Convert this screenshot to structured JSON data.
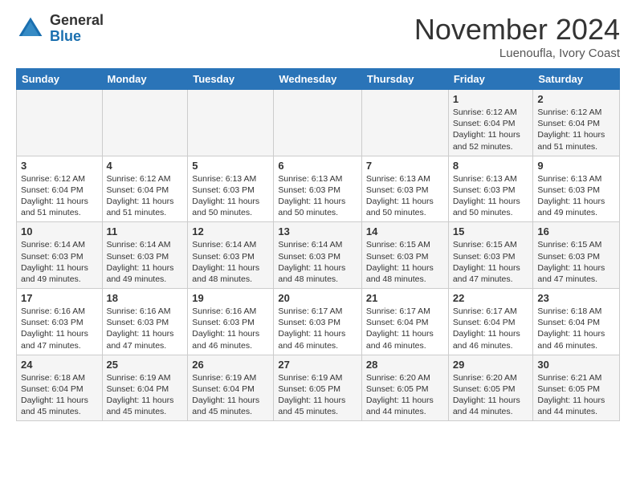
{
  "header": {
    "logo_general": "General",
    "logo_blue": "Blue",
    "month_title": "November 2024",
    "location": "Luenoufla, Ivory Coast"
  },
  "weekdays": [
    "Sunday",
    "Monday",
    "Tuesday",
    "Wednesday",
    "Thursday",
    "Friday",
    "Saturday"
  ],
  "weeks": [
    [
      {
        "day": "",
        "info": ""
      },
      {
        "day": "",
        "info": ""
      },
      {
        "day": "",
        "info": ""
      },
      {
        "day": "",
        "info": ""
      },
      {
        "day": "",
        "info": ""
      },
      {
        "day": "1",
        "info": "Sunrise: 6:12 AM\nSunset: 6:04 PM\nDaylight: 11 hours\nand 52 minutes."
      },
      {
        "day": "2",
        "info": "Sunrise: 6:12 AM\nSunset: 6:04 PM\nDaylight: 11 hours\nand 51 minutes."
      }
    ],
    [
      {
        "day": "3",
        "info": "Sunrise: 6:12 AM\nSunset: 6:04 PM\nDaylight: 11 hours\nand 51 minutes."
      },
      {
        "day": "4",
        "info": "Sunrise: 6:12 AM\nSunset: 6:04 PM\nDaylight: 11 hours\nand 51 minutes."
      },
      {
        "day": "5",
        "info": "Sunrise: 6:13 AM\nSunset: 6:03 PM\nDaylight: 11 hours\nand 50 minutes."
      },
      {
        "day": "6",
        "info": "Sunrise: 6:13 AM\nSunset: 6:03 PM\nDaylight: 11 hours\nand 50 minutes."
      },
      {
        "day": "7",
        "info": "Sunrise: 6:13 AM\nSunset: 6:03 PM\nDaylight: 11 hours\nand 50 minutes."
      },
      {
        "day": "8",
        "info": "Sunrise: 6:13 AM\nSunset: 6:03 PM\nDaylight: 11 hours\nand 50 minutes."
      },
      {
        "day": "9",
        "info": "Sunrise: 6:13 AM\nSunset: 6:03 PM\nDaylight: 11 hours\nand 49 minutes."
      }
    ],
    [
      {
        "day": "10",
        "info": "Sunrise: 6:14 AM\nSunset: 6:03 PM\nDaylight: 11 hours\nand 49 minutes."
      },
      {
        "day": "11",
        "info": "Sunrise: 6:14 AM\nSunset: 6:03 PM\nDaylight: 11 hours\nand 49 minutes."
      },
      {
        "day": "12",
        "info": "Sunrise: 6:14 AM\nSunset: 6:03 PM\nDaylight: 11 hours\nand 48 minutes."
      },
      {
        "day": "13",
        "info": "Sunrise: 6:14 AM\nSunset: 6:03 PM\nDaylight: 11 hours\nand 48 minutes."
      },
      {
        "day": "14",
        "info": "Sunrise: 6:15 AM\nSunset: 6:03 PM\nDaylight: 11 hours\nand 48 minutes."
      },
      {
        "day": "15",
        "info": "Sunrise: 6:15 AM\nSunset: 6:03 PM\nDaylight: 11 hours\nand 47 minutes."
      },
      {
        "day": "16",
        "info": "Sunrise: 6:15 AM\nSunset: 6:03 PM\nDaylight: 11 hours\nand 47 minutes."
      }
    ],
    [
      {
        "day": "17",
        "info": "Sunrise: 6:16 AM\nSunset: 6:03 PM\nDaylight: 11 hours\nand 47 minutes."
      },
      {
        "day": "18",
        "info": "Sunrise: 6:16 AM\nSunset: 6:03 PM\nDaylight: 11 hours\nand 47 minutes."
      },
      {
        "day": "19",
        "info": "Sunrise: 6:16 AM\nSunset: 6:03 PM\nDaylight: 11 hours\nand 46 minutes."
      },
      {
        "day": "20",
        "info": "Sunrise: 6:17 AM\nSunset: 6:03 PM\nDaylight: 11 hours\nand 46 minutes."
      },
      {
        "day": "21",
        "info": "Sunrise: 6:17 AM\nSunset: 6:04 PM\nDaylight: 11 hours\nand 46 minutes."
      },
      {
        "day": "22",
        "info": "Sunrise: 6:17 AM\nSunset: 6:04 PM\nDaylight: 11 hours\nand 46 minutes."
      },
      {
        "day": "23",
        "info": "Sunrise: 6:18 AM\nSunset: 6:04 PM\nDaylight: 11 hours\nand 46 minutes."
      }
    ],
    [
      {
        "day": "24",
        "info": "Sunrise: 6:18 AM\nSunset: 6:04 PM\nDaylight: 11 hours\nand 45 minutes."
      },
      {
        "day": "25",
        "info": "Sunrise: 6:19 AM\nSunset: 6:04 PM\nDaylight: 11 hours\nand 45 minutes."
      },
      {
        "day": "26",
        "info": "Sunrise: 6:19 AM\nSunset: 6:04 PM\nDaylight: 11 hours\nand 45 minutes."
      },
      {
        "day": "27",
        "info": "Sunrise: 6:19 AM\nSunset: 6:05 PM\nDaylight: 11 hours\nand 45 minutes."
      },
      {
        "day": "28",
        "info": "Sunrise: 6:20 AM\nSunset: 6:05 PM\nDaylight: 11 hours\nand 44 minutes."
      },
      {
        "day": "29",
        "info": "Sunrise: 6:20 AM\nSunset: 6:05 PM\nDaylight: 11 hours\nand 44 minutes."
      },
      {
        "day": "30",
        "info": "Sunrise: 6:21 AM\nSunset: 6:05 PM\nDaylight: 11 hours\nand 44 minutes."
      }
    ]
  ]
}
